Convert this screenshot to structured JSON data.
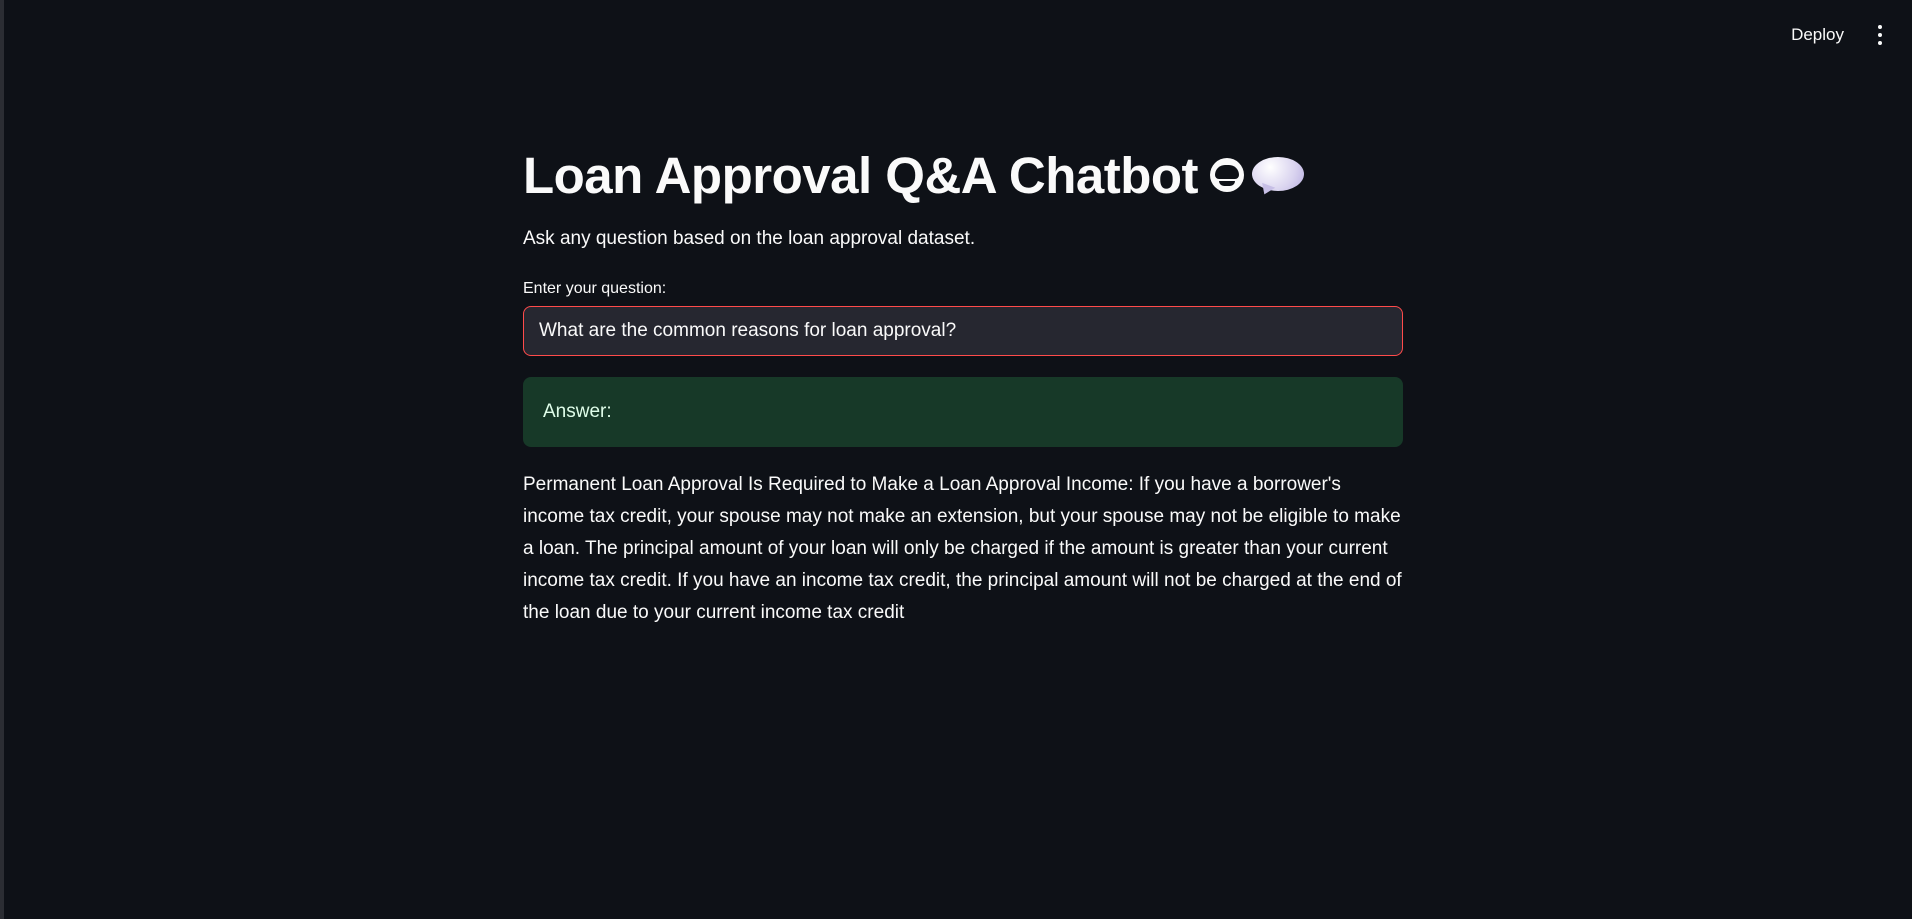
{
  "header": {
    "deploy_label": "Deploy",
    "menu_icon": "vertical-ellipsis-icon"
  },
  "main": {
    "title": "Loan Approval Q&A Chatbot",
    "title_icons": [
      "robot-face-icon",
      "speech-bubble-icon"
    ],
    "subtitle": "Ask any question based on the loan approval dataset.",
    "question_label": "Enter your question:",
    "question_value": "What are the common reasons for loan approval?",
    "answer_label": "Answer:",
    "answer_text": "Permanent Loan Approval Is Required to Make a Loan Approval Income: If you have a borrower's income tax credit, your spouse may not make an extension, but your spouse may not be eligible to make a loan. The principal amount of your loan will only be charged if the amount is greater than your current income tax credit. If you have an income tax credit, the principal amount will not be charged at the end of the loan due to your current income tax credit"
  },
  "colors": {
    "background": "#0e1117",
    "input_border_focus": "#ff4b4b",
    "success_box": "#173928"
  }
}
